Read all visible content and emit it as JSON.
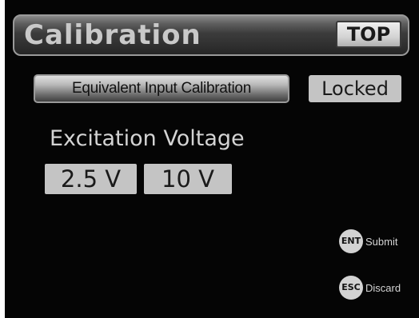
{
  "header": {
    "title": "Calibration",
    "top_button": "TOP"
  },
  "calibration": {
    "mode_button": "Equivalent Input Calibration",
    "status_badge": "Locked"
  },
  "excitation": {
    "label": "Excitation Voltage",
    "options": [
      "2.5 V",
      "10 V"
    ]
  },
  "footer": {
    "submit": {
      "key": "ENT",
      "label": "Submit"
    },
    "discard": {
      "key": "ESC",
      "label": "Discard"
    }
  }
}
